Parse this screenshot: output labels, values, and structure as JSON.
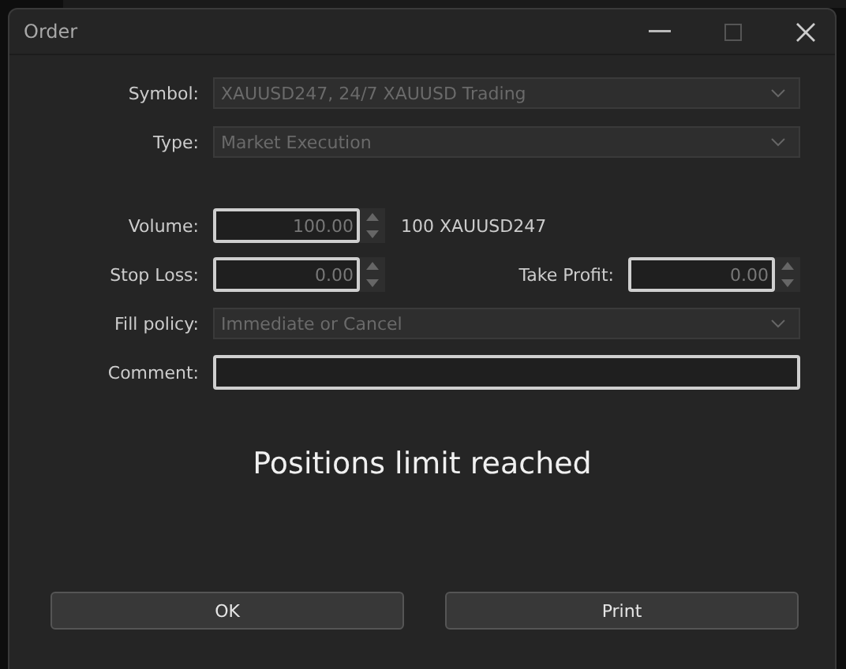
{
  "window": {
    "title": "Order"
  },
  "selects": [
    {
      "label": "Symbol:",
      "value": "XAUUSD247, 24/7 XAUUSD Trading",
      "disabled": true
    },
    {
      "label": "Type:",
      "value": "Market Execution",
      "disabled": true
    }
  ],
  "volume": {
    "label": "Volume:",
    "value": "100.00",
    "note": "100 XAUUSD247"
  },
  "stop_loss": {
    "label": "Stop Loss:",
    "value": "0.00"
  },
  "take_profit": {
    "label": "Take Profit:",
    "value": "0.00"
  },
  "fill_policy": {
    "label": "Fill policy:",
    "value": "Immediate or Cancel",
    "disabled": true
  },
  "comment": {
    "label": "Comment:"
  },
  "message": "Positions limit reached",
  "buttons": [
    "OK",
    "Print"
  ]
}
